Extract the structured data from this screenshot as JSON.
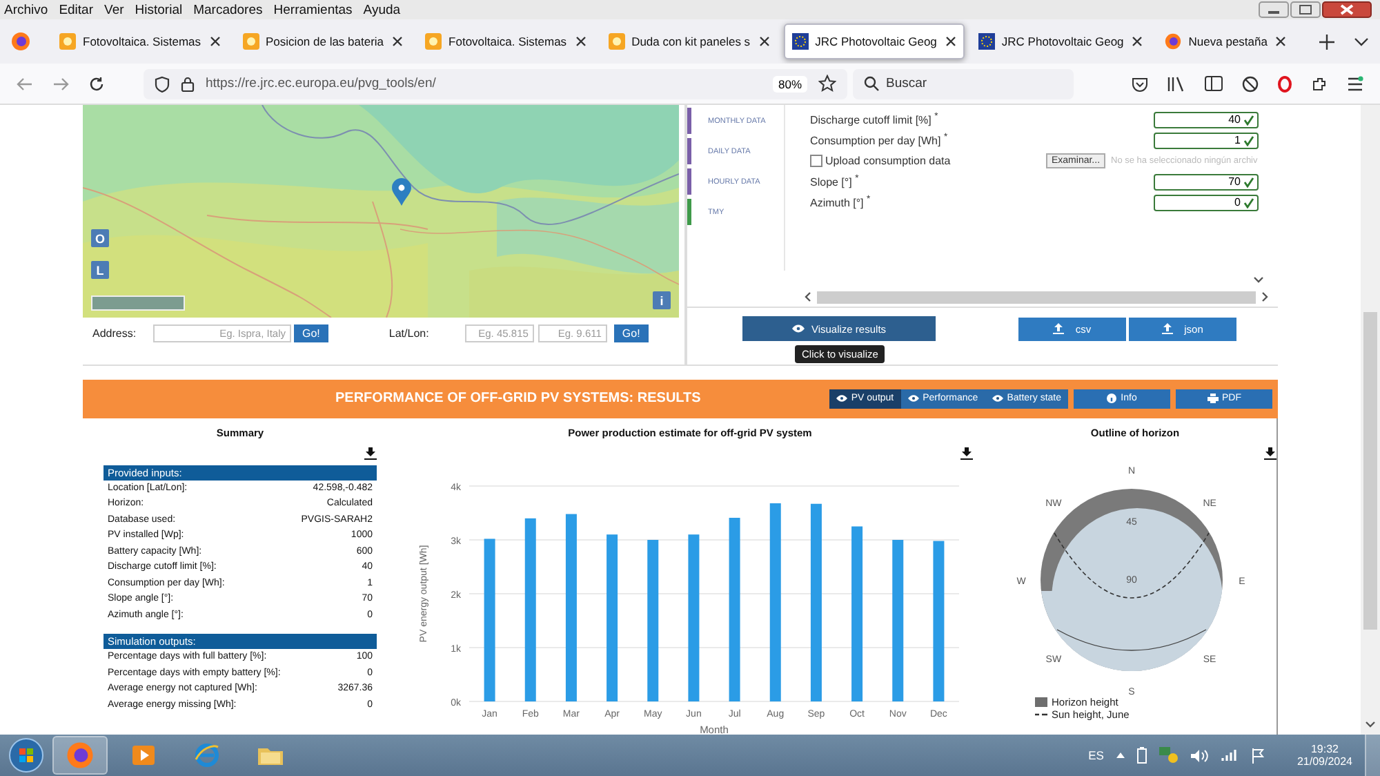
{
  "menu_bar": [
    "Archivo",
    "Editar",
    "Ver",
    "Historial",
    "Marcadores",
    "Herramientas",
    "Ayuda"
  ],
  "tabs": [
    {
      "title": "Fotovoltaica. Sistemas",
      "kind": "sun",
      "selected": false
    },
    {
      "title": "Posicion de las bateria",
      "kind": "sun",
      "selected": false
    },
    {
      "title": "Fotovoltaica. Sistemas",
      "kind": "sun",
      "selected": false
    },
    {
      "title": "Duda con kit paneles s",
      "kind": "sun",
      "selected": false
    },
    {
      "title": "JRC Photovoltaic Geog",
      "kind": "eu",
      "selected": true
    },
    {
      "title": "JRC Photovoltaic Geog",
      "kind": "eu",
      "selected": false
    },
    {
      "title": "Nueva pestaña",
      "kind": "firefox",
      "selected": false
    }
  ],
  "address_bar": {
    "url": "https://re.jrc.ec.europa.eu/pvg_tools/en/",
    "zoom": "80%"
  },
  "search": {
    "placeholder": "Buscar"
  },
  "map": {
    "layer_buttons": [
      "O",
      "L"
    ],
    "info_button": "i"
  },
  "location_row": {
    "address_label": "Address:",
    "address_placeholder": "Eg. Ispra, Italy",
    "address_go": "Go!",
    "latlon_label": "Lat/Lon:",
    "lat_placeholder": "Eg. 45.815",
    "lon_placeholder": "Eg. 9.611",
    "latlon_go": "Go!"
  },
  "side_tabs": [
    {
      "label": "MONTHLY DATA",
      "color": "#7a5fa8"
    },
    {
      "label": "DAILY DATA",
      "color": "#7a5fa8"
    },
    {
      "label": "HOURLY DATA",
      "color": "#7a5fa8"
    },
    {
      "label": "TMY",
      "color": "#3f9a4a"
    }
  ],
  "form_fields": [
    {
      "kind": "input",
      "label": "Discharge cutoff limit [%] $^{*}$",
      "value": "40"
    },
    {
      "kind": "input",
      "label": "Consumption per day [Wh] $^{*}$",
      "value": "1"
    },
    {
      "kind": "file",
      "label": "Upload consumption data",
      "checked": false,
      "button": "Examinar...",
      "status": "No se ha seleccionado ningún archiv"
    },
    {
      "kind": "input",
      "label": "Slope [°] $^{*}$",
      "value": "70"
    },
    {
      "kind": "input",
      "label": "Azimuth [°] $^{*}$",
      "value": "0"
    }
  ],
  "visualize_button": "Visualize results",
  "tooltip": "Click to visualize",
  "downloads": [
    "csv",
    "json"
  ],
  "results": {
    "title": "PERFORMANCE OF OFF-GRID PV SYSTEMS: RESULTS",
    "view_tabs": [
      {
        "label": "PV output",
        "selected": true
      },
      {
        "label": "Performance",
        "selected": false
      },
      {
        "label": "Battery state",
        "selected": false
      }
    ],
    "info_button": "Info",
    "pdf_button": "PDF"
  },
  "summary": {
    "title": "Summary",
    "sections": [
      {
        "heading": "Provided inputs:",
        "rows": [
          [
            "Location [Lat/Lon]:",
            "42.598,-0.482"
          ],
          [
            "Horizon:",
            "Calculated"
          ],
          [
            "Database used:",
            "PVGIS-SARAH2"
          ],
          [
            "PV installed [Wp]:",
            "1000"
          ],
          [
            "Battery capacity [Wh]:",
            "600"
          ],
          [
            "Discharge cutoff limit [%]:",
            "40"
          ],
          [
            "Consumption per day [Wh]:",
            "1"
          ],
          [
            "Slope angle [°]:",
            "70"
          ],
          [
            "Azimuth angle [°]:",
            "0"
          ]
        ]
      },
      {
        "heading": "Simulation outputs:",
        "rows": [
          [
            "Percentage days with full battery [%]:",
            "100"
          ],
          [
            "Percentage days with empty battery [%]:",
            "0"
          ],
          [
            "Average energy not captured [Wh]:",
            "3267.36"
          ],
          [
            "Average energy missing [Wh]:",
            "0"
          ]
        ]
      }
    ]
  },
  "production": {
    "title": "Power production estimate for off-grid PV system",
    "chart_data": {
      "type": "bar",
      "xlabel": "Month",
      "ylabel": "PV energy output [Wh]",
      "categories": [
        "Jan",
        "Feb",
        "Mar",
        "Apr",
        "May",
        "Jun",
        "Jul",
        "Aug",
        "Sep",
        "Oct",
        "Nov",
        "Dec"
      ],
      "grid": true,
      "series": [
        {
          "color": "#2b9ce6",
          "values": [
            3020,
            3400,
            3480,
            3100,
            3000,
            3100,
            3410,
            3680,
            3670,
            3250,
            3000,
            2980
          ]
        }
      ],
      "ylim": [
        0,
        4000
      ],
      "yticks": [
        {
          "value": 0,
          "label": "0k"
        },
        {
          "value": 1000,
          "label": "1k"
        },
        {
          "value": 2000,
          "label": "2k"
        },
        {
          "value": 3000,
          "label": "3k"
        },
        {
          "value": 4000,
          "label": "4k"
        }
      ]
    }
  },
  "horizon": {
    "title": "Outline of horizon",
    "directions": [
      "N",
      "NE",
      "E",
      "SE",
      "S",
      "SW",
      "W",
      "NW"
    ],
    "rings": [
      "45",
      "90"
    ],
    "legend": [
      {
        "label": "Horizon height",
        "kind": "area"
      },
      {
        "label": "Sun height, June",
        "kind": "dashed"
      }
    ]
  },
  "taskbar": {
    "language": "ES",
    "time": "19:32",
    "date": "21/09/2024"
  }
}
